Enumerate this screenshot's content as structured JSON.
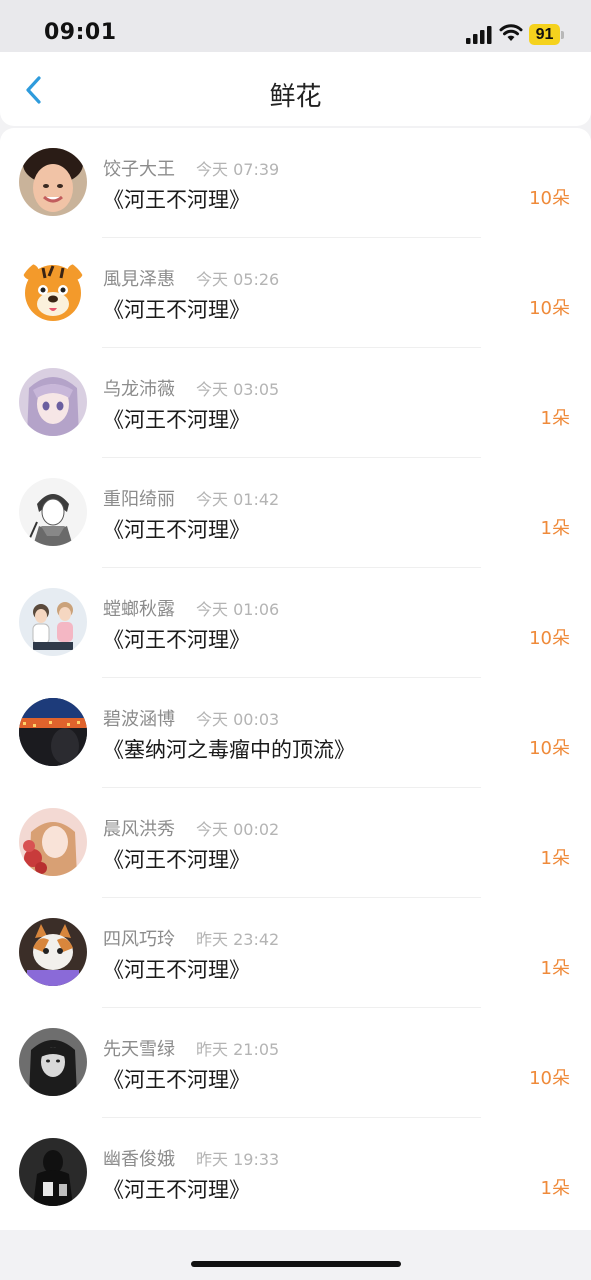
{
  "status_bar": {
    "time": "09:01",
    "battery_level": "91",
    "icons": [
      "signal-icon",
      "wifi-icon",
      "battery-icon"
    ]
  },
  "header": {
    "title": "鲜花",
    "back_icon": "chevron-left-icon",
    "accent_color": "#2e9bdc"
  },
  "gift_list": [
    {
      "name": "饺子大王",
      "time": "今天 07:39",
      "book": "《河王不河理》",
      "count": "10朵",
      "avatar": "photo-woman-smiling"
    },
    {
      "name": "風見泽惠",
      "time": "今天 05:26",
      "book": "《河王不河理》",
      "count": "10朵",
      "avatar": "cartoon-tiger"
    },
    {
      "name": "乌龙沛薇",
      "time": "今天 03:05",
      "book": "《河王不河理》",
      "count": "1朵",
      "avatar": "anime-girl"
    },
    {
      "name": "重阳绮丽",
      "time": "今天 01:42",
      "book": "《河王不河理》",
      "count": "1朵",
      "avatar": "sketch-boy"
    },
    {
      "name": "螳螂秋露",
      "time": "今天 01:06",
      "book": "《河王不河理》",
      "count": "10朵",
      "avatar": "couple-illustration"
    },
    {
      "name": "碧波涵博",
      "time": "今天 00:03",
      "book": "《塞纳河之毒瘤中的顶流》",
      "count": "10朵",
      "avatar": "city-night"
    },
    {
      "name": "晨风洪秀",
      "time": "今天 00:02",
      "book": "《河王不河理》",
      "count": "1朵",
      "avatar": "girl-with-flowers"
    },
    {
      "name": "四风巧玲",
      "time": "昨天 23:42",
      "book": "《河王不河理》",
      "count": "1朵",
      "avatar": "cat"
    },
    {
      "name": "先天雪绿",
      "time": "昨天 21:05",
      "book": "《河王不河理》",
      "count": "10朵",
      "avatar": "monochrome-portrait"
    },
    {
      "name": "幽香俊娥",
      "time": "昨天 19:33",
      "book": "《河王不河理》",
      "count": "1朵",
      "avatar": "dark-figure"
    }
  ],
  "colors": {
    "count_text": "#ef8a3a",
    "name_text": "#8c8c8c",
    "time_text": "#b4b4b4"
  }
}
